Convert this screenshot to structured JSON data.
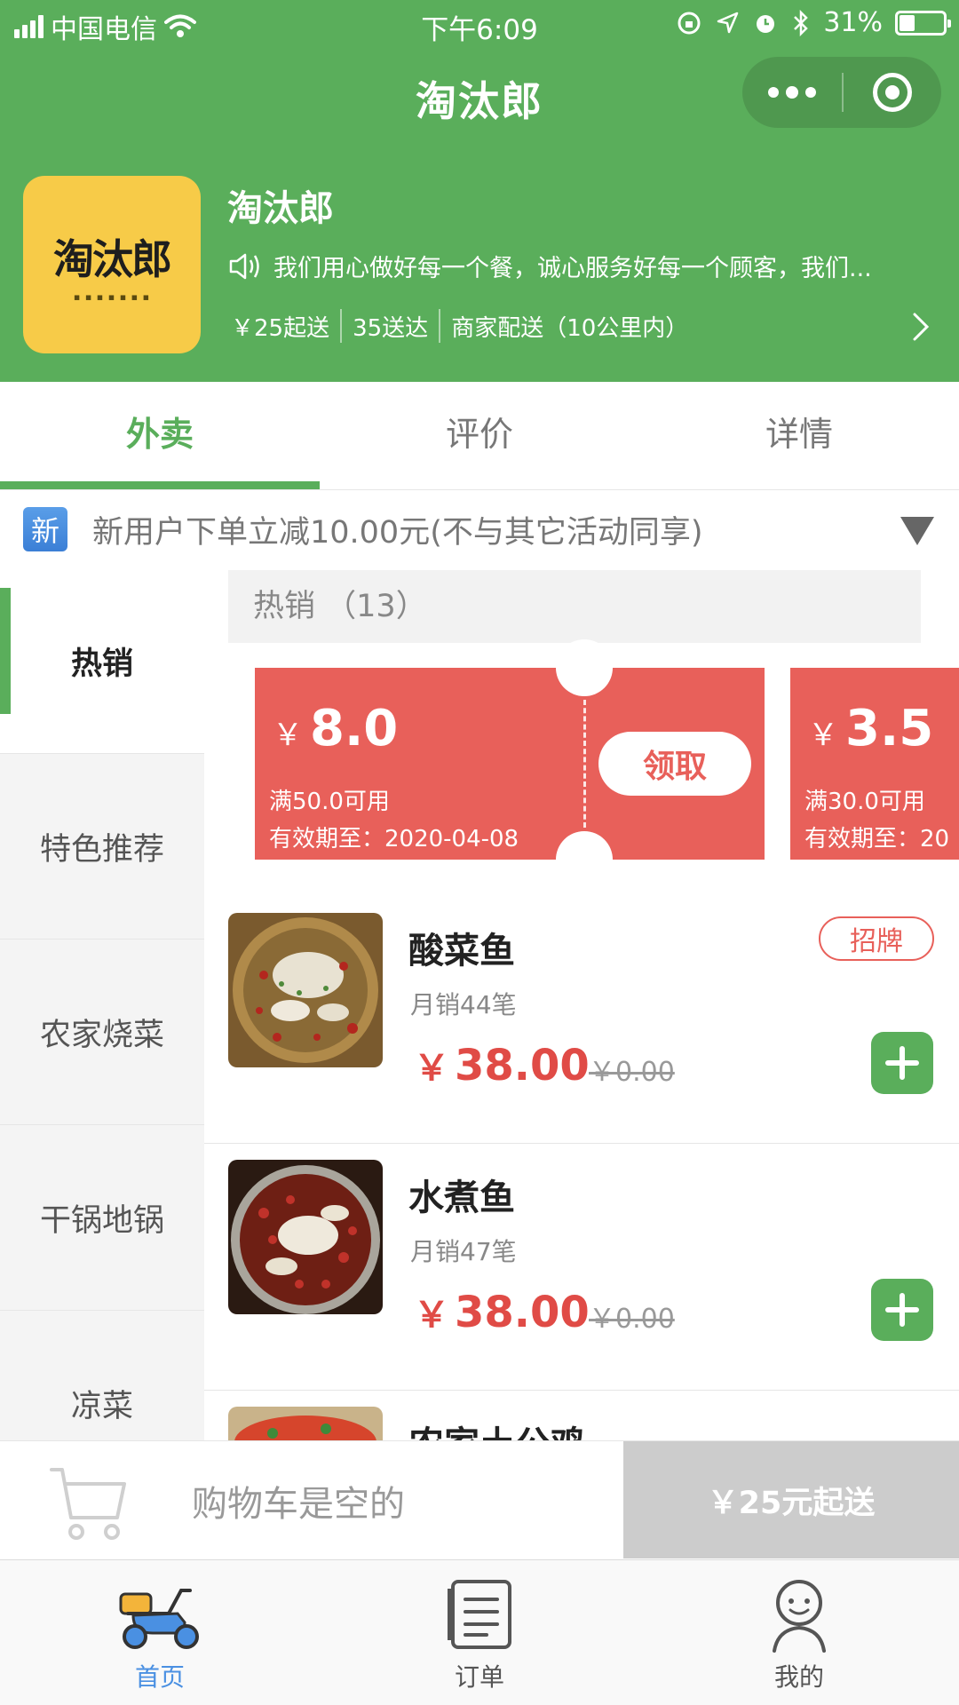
{
  "status_bar": {
    "carrier": "中国电信",
    "time": "下午6:09",
    "battery": "31%"
  },
  "nav": {
    "title": "淘汰郎"
  },
  "shop": {
    "logo_text": "淘汰郎",
    "name": "淘汰郎",
    "notice": "我们用心做好每一个餐，诚心服务好每一个顾客，我们...",
    "min_order": "￥25起送",
    "delivery_fee": "35送达",
    "delivery_type": "商家配送（10公里内）"
  },
  "tabs": [
    {
      "label": "外卖",
      "active": true
    },
    {
      "label": "评价",
      "active": false
    },
    {
      "label": "详情",
      "active": false
    }
  ],
  "promo": {
    "badge": "新",
    "text": "新用户下单立减10.00元(不与其它活动同享)"
  },
  "categories": [
    {
      "label": "热销",
      "active": true
    },
    {
      "label": "特色推荐",
      "active": false
    },
    {
      "label": "农家烧菜",
      "active": false
    },
    {
      "label": "干锅地锅",
      "active": false
    },
    {
      "label": "凉菜",
      "active": false
    }
  ],
  "section": {
    "title": "热销",
    "count": "（13）"
  },
  "coupons": [
    {
      "currency": "￥",
      "amount": "8.0",
      "condition": "满50.0可用",
      "expiry": "有效期至：2020-04-08",
      "button": "领取"
    },
    {
      "currency": "￥",
      "amount": "3.5",
      "condition": "满30.0可用",
      "expiry": "有效期至：20"
    }
  ],
  "dishes": [
    {
      "name": "酸菜鱼",
      "sales": "月销44笔",
      "currency": "￥",
      "price": "38.00",
      "original": "￥0.00",
      "badge": "招牌"
    },
    {
      "name": "水煮鱼",
      "sales": "月销47笔",
      "currency": "￥",
      "price": "38.00",
      "original": "￥0.00"
    },
    {
      "name": "农家土公鸡"
    }
  ],
  "cart": {
    "empty_text": "购物车是空的",
    "min_button": "￥25元起送"
  },
  "tabbar": [
    {
      "label": "首页",
      "icon": "scooter-icon",
      "active": true
    },
    {
      "label": "订单",
      "icon": "order-list-icon",
      "active": false
    },
    {
      "label": "我的",
      "icon": "profile-icon",
      "active": false
    }
  ],
  "colors": {
    "brand_green": "#5aae5b",
    "coupon_red": "#e8605a",
    "price_red": "#e04b46",
    "tab_active_blue": "#4a90e2"
  }
}
